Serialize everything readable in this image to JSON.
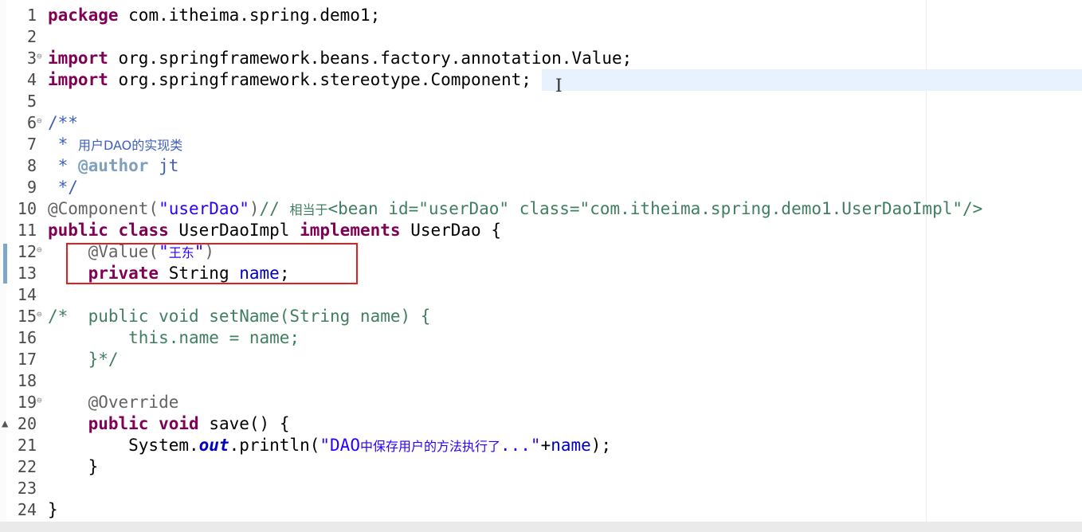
{
  "editor": {
    "lines": [
      {
        "num": "1",
        "tokens": [
          {
            "t": "package",
            "c": "kw"
          },
          {
            "t": " com.itheima.spring.demo1;",
            "c": ""
          }
        ]
      },
      {
        "num": "2",
        "tokens": []
      },
      {
        "num": "3",
        "fold": "⊖",
        "tokens": [
          {
            "t": "import",
            "c": "kw"
          },
          {
            "t": " org.springframework.beans.factory.annotation.Value;",
            "c": ""
          }
        ]
      },
      {
        "num": "4",
        "tokens": [
          {
            "t": "import",
            "c": "kw"
          },
          {
            "t": " org.springframework.stereotype.Component;",
            "c": ""
          }
        ]
      },
      {
        "num": "5",
        "tokens": []
      },
      {
        "num": "6",
        "fold": "⊖",
        "tokens": [
          {
            "t": "/**",
            "c": "jdoc"
          }
        ]
      },
      {
        "num": "7",
        "tokens": [
          {
            "t": " * ",
            "c": "jdoc"
          },
          {
            "t": "用户DAO的实现类",
            "c": "jdoc cjk"
          }
        ]
      },
      {
        "num": "8",
        "tokens": [
          {
            "t": " * ",
            "c": "jdoc"
          },
          {
            "t": "@author",
            "c": "jtag"
          },
          {
            "t": " jt",
            "c": "jdoc"
          }
        ]
      },
      {
        "num": "9",
        "tokens": [
          {
            "t": " */",
            "c": "jdoc"
          }
        ]
      },
      {
        "num": "10",
        "tokens": [
          {
            "t": "@Component(",
            "c": "ann"
          },
          {
            "t": "\"userDao\"",
            "c": "str"
          },
          {
            "t": ")",
            "c": "ann"
          },
          {
            "t": "// ",
            "c": "cmt"
          },
          {
            "t": "相当于",
            "c": "cmt cjk"
          },
          {
            "t": "<bean id=\"userDao\" class=\"com.itheima.spring.demo1.UserDaoImpl\"/>",
            "c": "cmt"
          }
        ]
      },
      {
        "num": "11",
        "tokens": [
          {
            "t": "public",
            "c": "kw"
          },
          {
            "t": " ",
            "c": ""
          },
          {
            "t": "class",
            "c": "kw"
          },
          {
            "t": " UserDaoImpl ",
            "c": ""
          },
          {
            "t": "implements",
            "c": "kw"
          },
          {
            "t": " UserDao {",
            "c": ""
          }
        ]
      },
      {
        "num": "12",
        "fold": "⊖",
        "tokens": [
          {
            "t": "    ",
            "c": ""
          },
          {
            "t": "@Value(",
            "c": "ann"
          },
          {
            "t": "\"",
            "c": "str"
          },
          {
            "t": "王东",
            "c": "str cjk"
          },
          {
            "t": "\"",
            "c": "str"
          },
          {
            "t": ")",
            "c": "ann"
          }
        ]
      },
      {
        "num": "13",
        "tokens": [
          {
            "t": "    ",
            "c": ""
          },
          {
            "t": "private",
            "c": "kw"
          },
          {
            "t": " String ",
            "c": ""
          },
          {
            "t": "name",
            "c": "field"
          },
          {
            "t": ";",
            "c": ""
          }
        ]
      },
      {
        "num": "14",
        "tokens": []
      },
      {
        "num": "15",
        "fold": "⊖",
        "tokens": [
          {
            "t": "/*  public void setName(String name) {",
            "c": "cmt"
          }
        ]
      },
      {
        "num": "16",
        "tokens": [
          {
            "t": "        this.name = name;",
            "c": "cmt"
          }
        ]
      },
      {
        "num": "17",
        "tokens": [
          {
            "t": "    }*/",
            "c": "cmt"
          }
        ]
      },
      {
        "num": "18",
        "tokens": []
      },
      {
        "num": "19",
        "fold": "⊖",
        "tokens": [
          {
            "t": "    ",
            "c": ""
          },
          {
            "t": "@Override",
            "c": "ann"
          }
        ]
      },
      {
        "num": "20",
        "marker": "▲",
        "tokens": [
          {
            "t": "    ",
            "c": ""
          },
          {
            "t": "public",
            "c": "kw"
          },
          {
            "t": " ",
            "c": ""
          },
          {
            "t": "void",
            "c": "kw"
          },
          {
            "t": " save() {",
            "c": ""
          }
        ]
      },
      {
        "num": "21",
        "tokens": [
          {
            "t": "        System.",
            "c": ""
          },
          {
            "t": "out",
            "c": "static"
          },
          {
            "t": ".println(",
            "c": ""
          },
          {
            "t": "\"DAO",
            "c": "str"
          },
          {
            "t": "中保存用户的方法执行了",
            "c": "str cjk"
          },
          {
            "t": "...\"",
            "c": "str"
          },
          {
            "t": "+",
            "c": ""
          },
          {
            "t": "name",
            "c": "field"
          },
          {
            "t": ");",
            "c": ""
          }
        ]
      },
      {
        "num": "22",
        "tokens": [
          {
            "t": "    }",
            "c": ""
          }
        ]
      },
      {
        "num": "23",
        "tokens": []
      },
      {
        "num": "24",
        "tokens": [
          {
            "t": "}",
            "c": ""
          }
        ]
      }
    ],
    "current_line": 4
  }
}
